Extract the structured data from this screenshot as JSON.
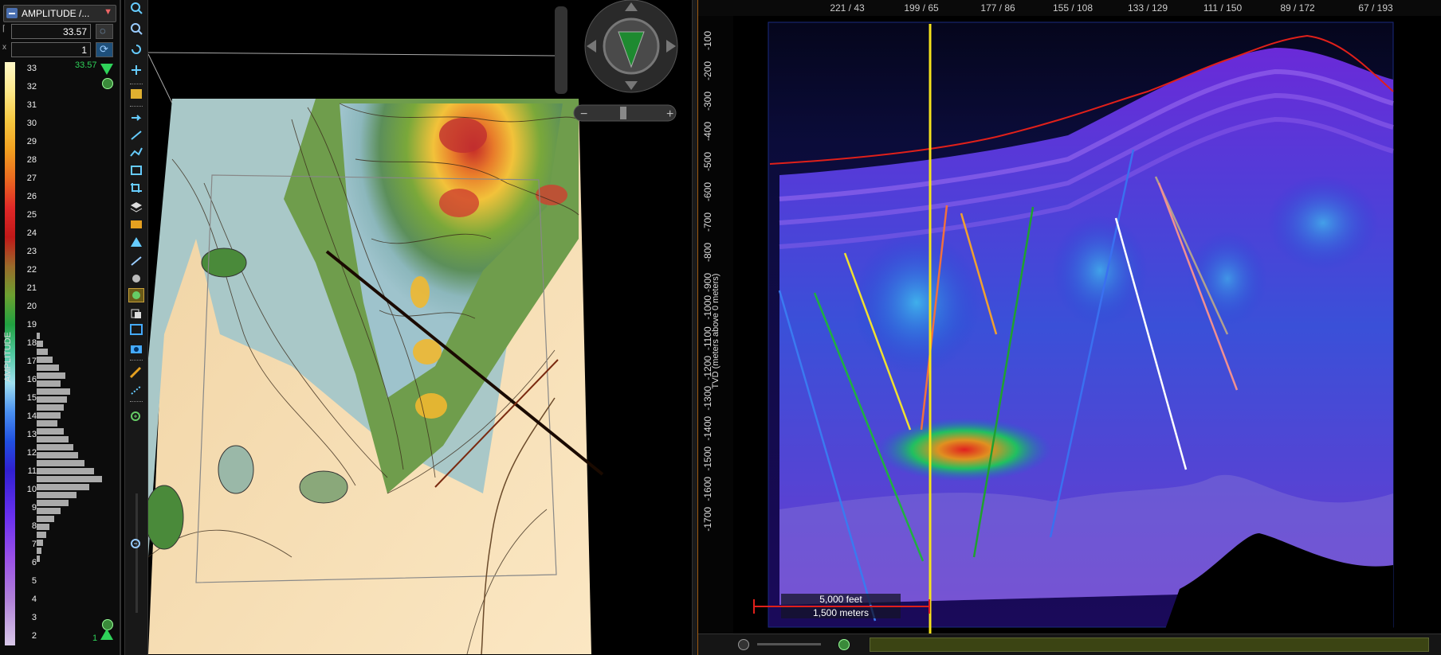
{
  "color_bar": {
    "attribute_label": "AMPLITUDE /...",
    "max_value": "33.57",
    "min_value": "1",
    "max_marker": "33.57",
    "min_marker": "1",
    "vertical_label": "AMPLITUDE",
    "ticks": [
      "33",
      "32",
      "31",
      "30",
      "29",
      "28",
      "27",
      "26",
      "25",
      "24",
      "23",
      "22",
      "21",
      "20",
      "19",
      "18",
      "17",
      "16",
      "15",
      "14",
      "13",
      "12",
      "11",
      "10",
      "9",
      "8",
      "7",
      "6",
      "5",
      "4",
      "3",
      "2"
    ]
  },
  "section_view": {
    "top_axis_labels": [
      "221 / 43",
      "199 / 65",
      "177 / 86",
      "155 / 108",
      "133 / 129",
      "111 / 150",
      "89 / 172",
      "67 / 193"
    ],
    "y_axis_title": "TVD (meters above 0 meters)",
    "y_ticks": [
      "-100",
      "-200",
      "-300",
      "-400",
      "-500",
      "-600",
      "-700",
      "-800",
      "-900",
      "-1000",
      "-1100",
      "-1200",
      "-1300",
      "-1400",
      "-1500",
      "-1600",
      "-1700"
    ],
    "scale_feet": "5,000 feet",
    "scale_meters": "1,500 meters"
  },
  "icons": {
    "nav_compass": "navigation-compass-icon",
    "zoom_in": "zoom-in-icon",
    "zoom_out": "zoom-out-icon"
  },
  "colors": {
    "accent_orange": "#a05a10",
    "marker_green": "#2fd35a",
    "horizon_red": "#e0201a",
    "well_yellow": "#f4e21c"
  }
}
